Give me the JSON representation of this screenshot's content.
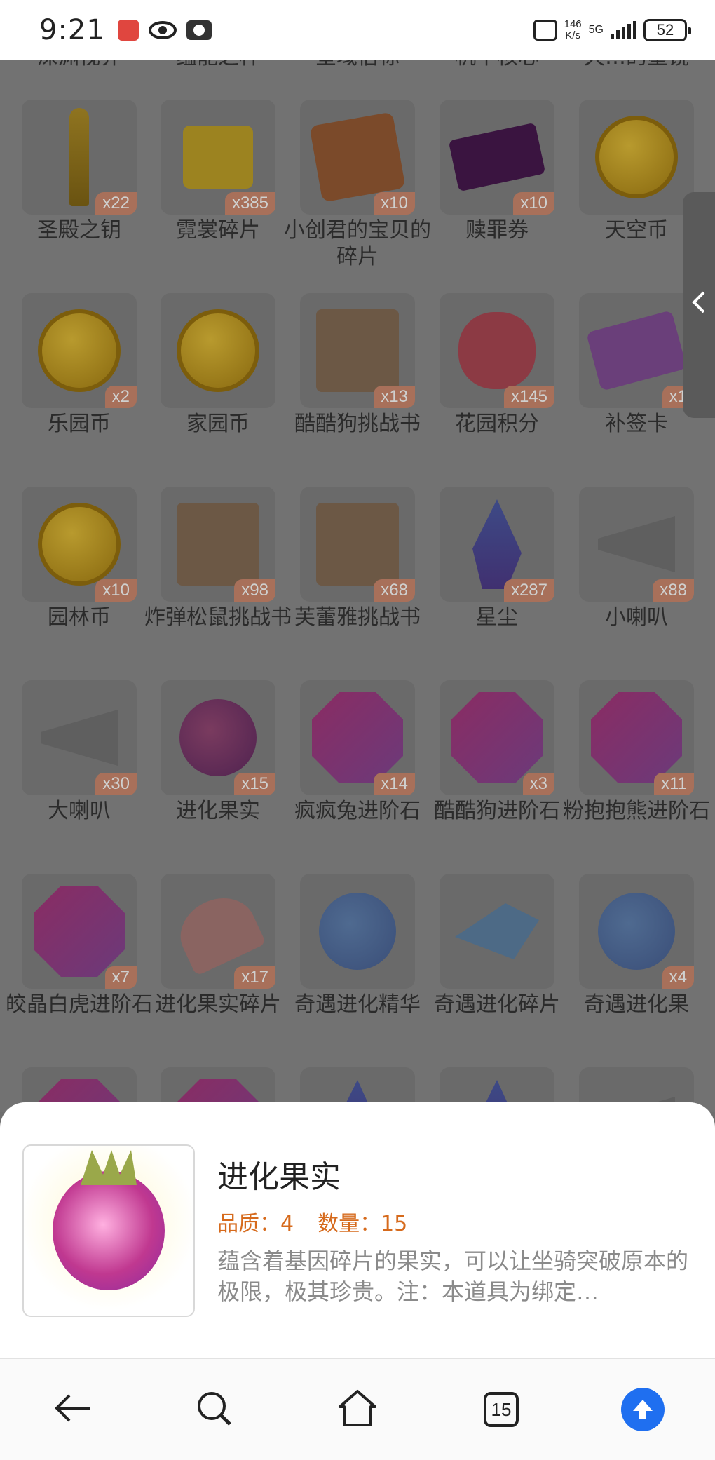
{
  "status_bar": {
    "time": "9:21",
    "net_speed_value": "146",
    "net_speed_unit": "K/s",
    "network": "5G",
    "battery": "52"
  },
  "cut_row_labels": [
    "深渊视界",
    "蕴能之种",
    "星域信标",
    "机甲核心",
    "天…的墨镜"
  ],
  "items": [
    {
      "name": "圣殿之钥",
      "count": "x22",
      "icon": "key-icon"
    },
    {
      "name": "霓裳碎片",
      "count": "x385",
      "icon": "shirt-icon"
    },
    {
      "name": "小创君的宝贝的碎片",
      "count": "x10",
      "icon": "puzzle-icon"
    },
    {
      "name": "赎罪券",
      "count": "x10",
      "icon": "ticket-icon"
    },
    {
      "name": "天空币",
      "count": "",
      "icon": "coin-icon"
    },
    {
      "name": "乐园币",
      "count": "x2",
      "icon": "coin-icon"
    },
    {
      "name": "家园币",
      "count": "",
      "icon": "coin-icon"
    },
    {
      "name": "酷酷狗挑战书",
      "count": "x13",
      "icon": "wanted-scroll-icon"
    },
    {
      "name": "花园积分",
      "count": "x145",
      "icon": "flower-icon"
    },
    {
      "name": "补签卡",
      "count": "x1",
      "icon": "card-icon"
    },
    {
      "name": "园林币",
      "count": "x10",
      "icon": "coin-icon"
    },
    {
      "name": "炸弹松鼠挑战书",
      "count": "x98",
      "icon": "wanted-scroll-icon"
    },
    {
      "name": "芙蕾雅挑战书",
      "count": "x68",
      "icon": "wanted-scroll-icon"
    },
    {
      "name": "星尘",
      "count": "x287",
      "icon": "crystal-icon"
    },
    {
      "name": "小喇叭",
      "count": "x88",
      "icon": "megaphone-icon"
    },
    {
      "name": "大喇叭",
      "count": "x30",
      "icon": "megaphone-icon"
    },
    {
      "name": "进化果实",
      "count": "x15",
      "icon": "berry-icon"
    },
    {
      "name": "疯疯兔进阶石",
      "count": "x14",
      "icon": "gem-icon"
    },
    {
      "name": "酷酷狗进阶石",
      "count": "x3",
      "icon": "gem-icon"
    },
    {
      "name": "粉抱抱熊进阶石",
      "count": "x11",
      "icon": "gem-icon"
    },
    {
      "name": "皎晶白虎进阶石",
      "count": "x7",
      "icon": "gem-icon"
    },
    {
      "name": "进化果实碎片",
      "count": "x17",
      "icon": "fruit-slice-icon"
    },
    {
      "name": "奇遇进化精华",
      "count": "",
      "icon": "blueberry-icon"
    },
    {
      "name": "奇遇进化碎片",
      "count": "",
      "icon": "shard-icon"
    },
    {
      "name": "奇遇进化果",
      "count": "x4",
      "icon": "blueberry-icon"
    }
  ],
  "side_handle": {
    "icon": "chevron-left-icon"
  },
  "detail": {
    "title": "进化果实",
    "quality_label": "品质：4",
    "quantity_label": "数量：15",
    "description": "蕴含着基因碎片的果实，可以让坐骑突破原本的极限，极其珍贵。注：本道具为绑定…",
    "icon": "berry-icon"
  },
  "browser_nav": {
    "tab_count": "15",
    "icons": [
      "back-arrow-icon",
      "search-icon",
      "home-icon",
      "tabs-icon",
      "scroll-top-icon"
    ]
  }
}
